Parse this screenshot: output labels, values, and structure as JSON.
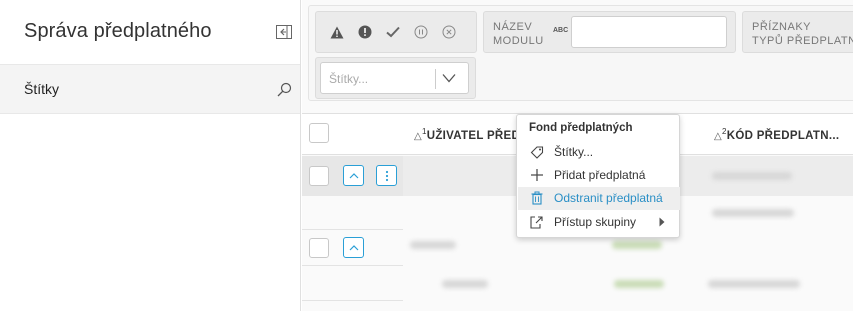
{
  "sidebar": {
    "title": "Správa předplatného",
    "items": [
      {
        "label": "Štítky"
      }
    ]
  },
  "filters": {
    "module": {
      "label_line1": "NÁZEV",
      "label_line2": "MODULU",
      "abc": "ABC",
      "value": ""
    },
    "flags": {
      "label_line1": "PŘÍZNAKY",
      "label_line2": "TYPŮ PŘEDPLATNÉHO"
    },
    "tags": {
      "placeholder": "Štítky..."
    }
  },
  "grid": {
    "columns": [
      {
        "sort_index": "1",
        "label": "UŽIVATEL PŘEDPLATNÉHO"
      },
      {
        "sort_index": "2",
        "label": "KÓD PŘEDPLATN..."
      }
    ]
  },
  "context_menu": {
    "title": "Fond předplatných",
    "items": [
      {
        "label": "Štítky...",
        "icon": "tag-icon"
      },
      {
        "label": "Přidat předplatná",
        "icon": "plus-icon"
      },
      {
        "label": "Odstranit předplatná",
        "icon": "trash-icon",
        "active": true
      },
      {
        "label": "Přístup skupiny",
        "icon": "share-icon",
        "submenu": true
      }
    ]
  },
  "colors": {
    "accent": "#2a9fd6",
    "active_text": "#2a8fc6",
    "selected_row": "#e7e7e7"
  }
}
